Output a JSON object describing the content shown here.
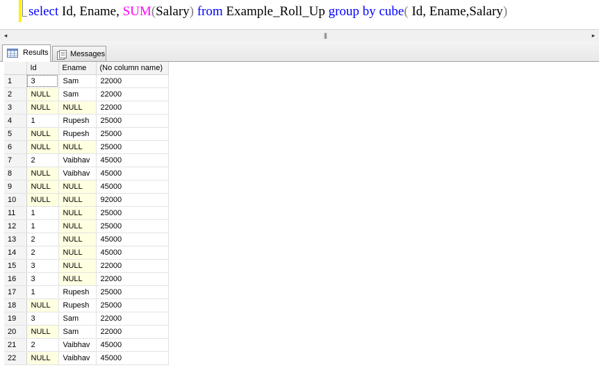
{
  "query": {
    "tokens": [
      {
        "text": "select",
        "cls": "kw"
      },
      {
        "text": " Id, Ename, ",
        "cls": ""
      },
      {
        "text": "SUM",
        "cls": "fn"
      },
      {
        "text": "(",
        "cls": "gr"
      },
      {
        "text": "Salary",
        "cls": ""
      },
      {
        "text": ")",
        "cls": "gr"
      },
      {
        "text": " ",
        "cls": ""
      },
      {
        "text": "from",
        "cls": "kw"
      },
      {
        "text": " Example_Roll_Up ",
        "cls": ""
      },
      {
        "text": "group by",
        "cls": "kw"
      },
      {
        "text": " ",
        "cls": ""
      },
      {
        "text": "cube",
        "cls": "kw"
      },
      {
        "text": "(",
        "cls": "gr"
      },
      {
        "text": " Id, Ename,Salary",
        "cls": ""
      },
      {
        "text": ")",
        "cls": "gr"
      }
    ]
  },
  "scrollbar": {
    "left_arrow": "◂",
    "splitter": "|||",
    "right_arrow": "▸"
  },
  "tabs": [
    {
      "label": "Results",
      "icon": "grid-icon",
      "active": true
    },
    {
      "label": "Messages",
      "icon": "messages-icon",
      "active": false
    }
  ],
  "grid": {
    "columns": [
      "",
      "Id",
      "Ename",
      "(No column name)"
    ],
    "rows": [
      {
        "n": "1",
        "id": "3",
        "ename": "Sam",
        "salary": "22000"
      },
      {
        "n": "2",
        "id": "NULL",
        "ename": "Sam",
        "salary": "22000"
      },
      {
        "n": "3",
        "id": "NULL",
        "ename": "NULL",
        "salary": "22000"
      },
      {
        "n": "4",
        "id": "1",
        "ename": "Rupesh",
        "salary": "25000"
      },
      {
        "n": "5",
        "id": "NULL",
        "ename": "Rupesh",
        "salary": "25000"
      },
      {
        "n": "6",
        "id": "NULL",
        "ename": "NULL",
        "salary": "25000"
      },
      {
        "n": "7",
        "id": "2",
        "ename": "Vaibhav",
        "salary": "45000"
      },
      {
        "n": "8",
        "id": "NULL",
        "ename": "Vaibhav",
        "salary": "45000"
      },
      {
        "n": "9",
        "id": "NULL",
        "ename": "NULL",
        "salary": "45000"
      },
      {
        "n": "10",
        "id": "NULL",
        "ename": "NULL",
        "salary": "92000"
      },
      {
        "n": "11",
        "id": "1",
        "ename": "NULL",
        "salary": "25000"
      },
      {
        "n": "12",
        "id": "1",
        "ename": "NULL",
        "salary": "25000"
      },
      {
        "n": "13",
        "id": "2",
        "ename": "NULL",
        "salary": "45000"
      },
      {
        "n": "14",
        "id": "2",
        "ename": "NULL",
        "salary": "45000"
      },
      {
        "n": "15",
        "id": "3",
        "ename": "NULL",
        "salary": "22000"
      },
      {
        "n": "16",
        "id": "3",
        "ename": "NULL",
        "salary": "22000"
      },
      {
        "n": "17",
        "id": "1",
        "ename": "Rupesh",
        "salary": "25000"
      },
      {
        "n": "18",
        "id": "NULL",
        "ename": "Rupesh",
        "salary": "25000"
      },
      {
        "n": "19",
        "id": "3",
        "ename": "Sam",
        "salary": "22000"
      },
      {
        "n": "20",
        "id": "NULL",
        "ename": "Sam",
        "salary": "22000"
      },
      {
        "n": "21",
        "id": "2",
        "ename": "Vaibhav",
        "salary": "45000"
      },
      {
        "n": "22",
        "id": "NULL",
        "ename": "Vaibhav",
        "salary": "45000"
      }
    ],
    "null_color": "#ffffe1",
    "selected_cell": "1:id"
  },
  "colors": {
    "keyword": "#0000ff",
    "function": "#ff00ff",
    "operator": "#808080",
    "change_marker": "#fff200"
  }
}
